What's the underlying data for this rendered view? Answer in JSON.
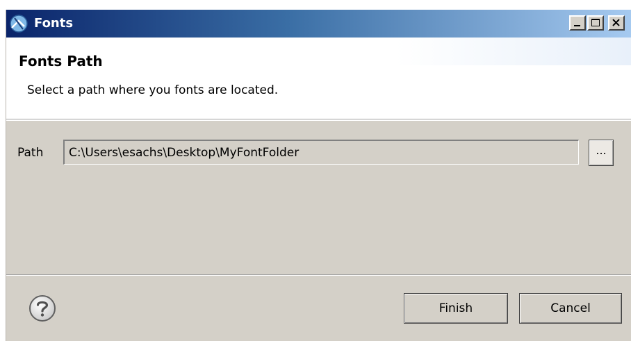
{
  "window": {
    "title": "Fonts"
  },
  "titlebar_buttons": [
    "minimize",
    "maximize",
    "close"
  ],
  "banner": {
    "title": "Fonts Path",
    "description": "Select a path where you fonts are located."
  },
  "form": {
    "path_label": "Path",
    "path_value": "C:\\Users\\esachs\\Desktop\\MyFontFolder",
    "browse_label": "..."
  },
  "footer": {
    "help_icon": "question-circle-icon",
    "finish_label": "Finish",
    "cancel_label": "Cancel"
  },
  "colors": {
    "titlebar_start": "#0a246a",
    "titlebar_end": "#a6caf0",
    "dialog_background": "#d4d0c8",
    "banner_background": "#ffffff"
  }
}
